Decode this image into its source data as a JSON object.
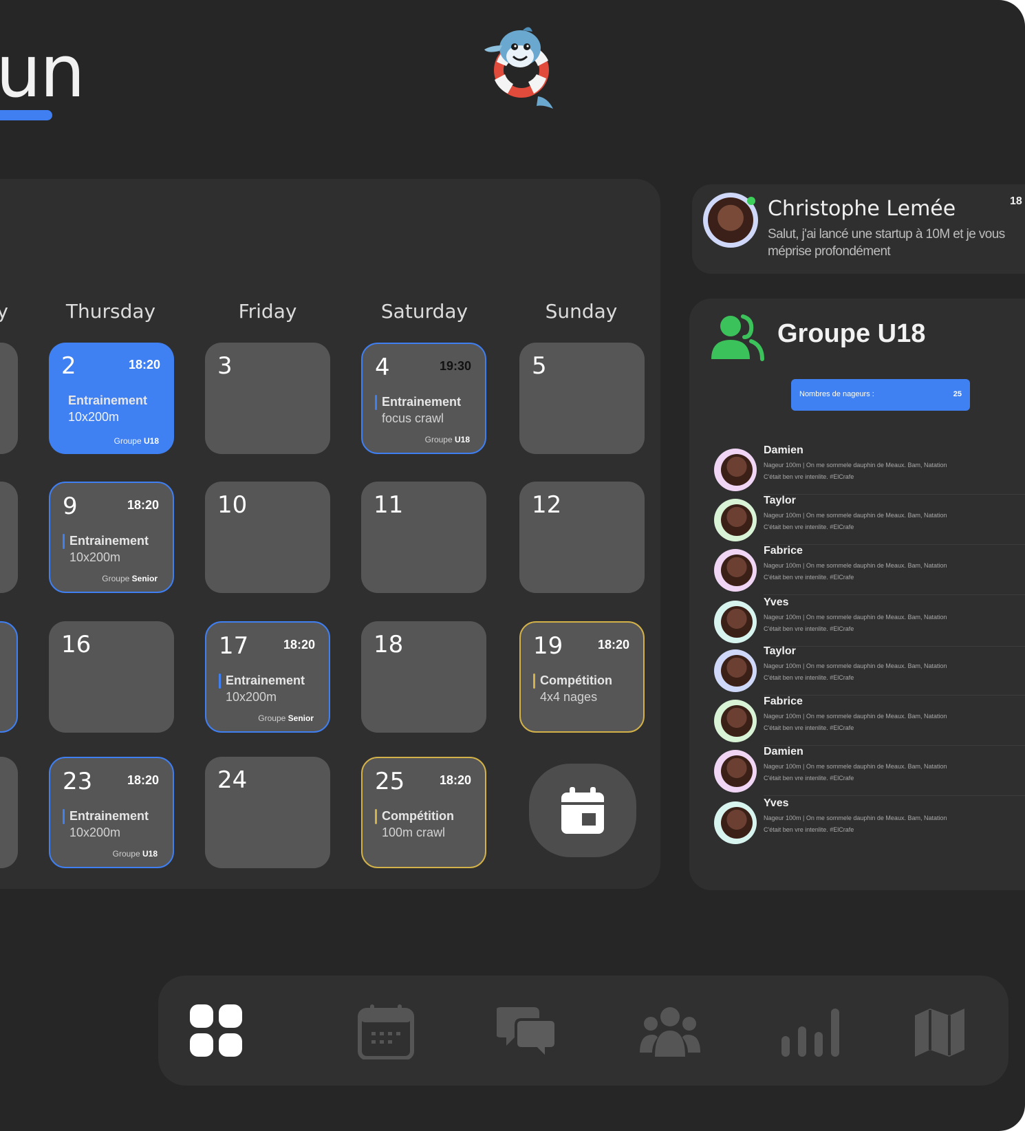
{
  "header": {
    "title_fragment": "un"
  },
  "calendar": {
    "days": [
      "y",
      "Thursday",
      "Friday",
      "Saturday",
      "Sunday"
    ],
    "cells": [
      {
        "num": "2",
        "time": "18:20",
        "title": "Entrainement",
        "sub": "10x200m",
        "group_prefix": "Groupe ",
        "group": "U18"
      },
      {
        "num": "3"
      },
      {
        "num": "4",
        "time": "19:30",
        "title": "Entrainement",
        "sub": "focus crawl",
        "group_prefix": "Groupe ",
        "group": "U18"
      },
      {
        "num": "5"
      },
      {
        "num": "9",
        "time": "18:20",
        "title": "Entrainement",
        "sub": "10x200m",
        "group_prefix": "Groupe ",
        "group": "Senior"
      },
      {
        "num": "10"
      },
      {
        "num": "11"
      },
      {
        "num": "12"
      },
      {
        "num": "16"
      },
      {
        "num": "17",
        "time": "18:20",
        "title": "Entrainement",
        "sub": "10x200m",
        "group_prefix": "Groupe ",
        "group": "Senior"
      },
      {
        "num": "18"
      },
      {
        "num": "19",
        "time": "18:20",
        "title": "Compétition",
        "sub": "4x4 nages"
      },
      {
        "num": "23",
        "time": "18:20",
        "title": "Entrainement",
        "sub": "10x200m",
        "group_prefix": "Groupe ",
        "group": "U18"
      },
      {
        "num": "24"
      },
      {
        "num": "25",
        "time": "18:20",
        "title": "Compétition",
        "sub": "100m crawl"
      }
    ],
    "colors": {
      "primary": "#3f80f2",
      "competition": "#d3b24a",
      "cell": "#565656"
    }
  },
  "message": {
    "name": "Christophe Lemée",
    "time": "18",
    "text": "Salut, j'ai lancé une startup à 10M et je vous méprise profondément"
  },
  "group": {
    "title": "Groupe U18",
    "count_label": "Nombres de nageurs :",
    "count": "25",
    "members": [
      {
        "name": "Damien",
        "desc": "Nageur 100m | On me sommele dauphin de Meaux. Bam, Natation",
        "desc2": "C'était ben vre intenlite. #ElCrafe",
        "ring": "#f0d5f5"
      },
      {
        "name": "Taylor",
        "desc": "Nageur 100m | On me sommele dauphin de Meaux. Bam, Natation",
        "desc2": "C'était ben vre intenlite. #ElCrafe",
        "ring": "#d8f3d5"
      },
      {
        "name": "Fabrice",
        "desc": "Nageur 100m | On me sommele dauphin de Meaux. Bam, Natation",
        "desc2": "C'était ben vre intenlite. #ElCrafe",
        "ring": "#f0d5f5"
      },
      {
        "name": "Yves",
        "desc": "Nageur 100m | On me sommele dauphin de Meaux. Bam, Natation",
        "desc2": "C'était ben vre intenlite. #ElCrafe",
        "ring": "#d8f4ef"
      },
      {
        "name": "Taylor",
        "desc": "Nageur 100m | On me sommele dauphin de Meaux. Bam, Natation",
        "desc2": "C'était ben vre intenlite. #ElCrafe",
        "ring": "#cfd8f8"
      },
      {
        "name": "Fabrice",
        "desc": "Nageur 100m | On me sommele dauphin de Meaux. Bam, Natation",
        "desc2": "C'était ben vre intenlite. #ElCrafe",
        "ring": "#d8f3d5"
      },
      {
        "name": "Damien",
        "desc": "Nageur 100m | On me sommele dauphin de Meaux. Bam, Natation",
        "desc2": "C'était ben vre intenlite. #ElCrafe",
        "ring": "#f0d5f5"
      },
      {
        "name": "Yves",
        "desc": "Nageur 100m | On me sommele dauphin de Meaux. Bam, Natation",
        "desc2": "C'était ben vre intenlite. #ElCrafe",
        "ring": "#d8f4ef"
      }
    ]
  },
  "nav": {
    "items": [
      {
        "icon": "dashboard-grid-icon",
        "active": true
      },
      {
        "icon": "calendar-icon",
        "active": false
      },
      {
        "icon": "chat-bubbles-icon",
        "active": false
      },
      {
        "icon": "team-icon",
        "active": false
      },
      {
        "icon": "bar-chart-icon",
        "active": false
      },
      {
        "icon": "map-icon",
        "active": false
      }
    ],
    "active_color": "#ffffff",
    "inactive_color": "#555555"
  }
}
